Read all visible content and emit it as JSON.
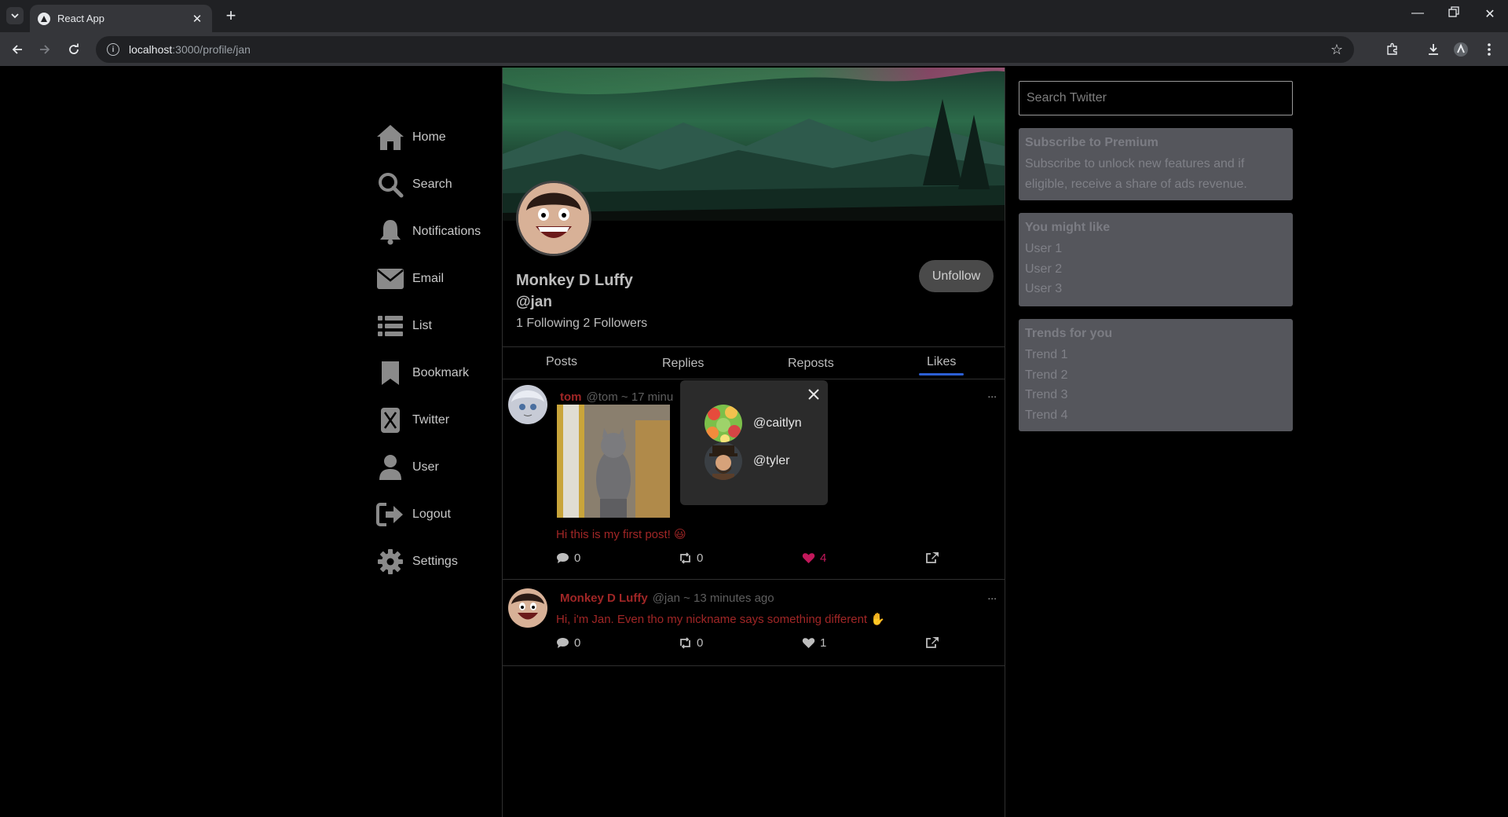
{
  "browser": {
    "tab_title": "React App",
    "url_host": "localhost",
    "url_path": ":3000/profile/jan"
  },
  "nav": [
    {
      "label": "Home",
      "icon": "home-icon"
    },
    {
      "label": "Search",
      "icon": "search-icon"
    },
    {
      "label": "Notifications",
      "icon": "bell-icon"
    },
    {
      "label": "Email",
      "icon": "envelope-icon"
    },
    {
      "label": "List",
      "icon": "list-icon"
    },
    {
      "label": "Bookmark",
      "icon": "bookmark-icon"
    },
    {
      "label": "Twitter",
      "icon": "x-logo-icon"
    },
    {
      "label": "User",
      "icon": "user-icon"
    },
    {
      "label": "Logout",
      "icon": "logout-icon"
    },
    {
      "label": "Settings",
      "icon": "gear-icon"
    }
  ],
  "profile": {
    "name": "Monkey D Luffy",
    "handle": "@jan",
    "follow_stats": "1 Following 2 Followers",
    "unfollow_label": "Unfollow"
  },
  "tabs": [
    "Posts",
    "Replies",
    "Reposts",
    "Likes"
  ],
  "active_tab": "Likes",
  "posts": [
    {
      "name": "tom",
      "meta": "@tom ~ 17 minu",
      "text": "Hi this is my first post! 😃",
      "comments": "0",
      "reposts": "0",
      "likes": "4",
      "more": "..."
    },
    {
      "name": "Monkey D Luffy",
      "meta": "@jan ~ 13 minutes ago",
      "text": "Hi, i'm Jan. Even tho my nickname says something different ✋",
      "comments": "0",
      "reposts": "0",
      "likes": "1",
      "more": "..."
    }
  ],
  "likes_popup": {
    "users": [
      "@caitlyn",
      "@tyler"
    ]
  },
  "sidebar": {
    "search_placeholder": "Search Twitter",
    "premium": {
      "title": "Subscribe to Premium",
      "text": "Subscribe to unlock new features and if eligible, receive a share of ads revenue."
    },
    "might_like": {
      "title": "You might like",
      "items": [
        "User 1",
        "User 2",
        "User 3"
      ]
    },
    "trends": {
      "title": "Trends for you",
      "items": [
        "Trend 1",
        "Trend 2",
        "Trend 3",
        "Trend 4"
      ]
    }
  },
  "colors": {
    "accent_red": "#a02626",
    "like_pink": "#c2185b",
    "tab_underline": "#2c5fd4",
    "card_bg": "#55565c"
  }
}
